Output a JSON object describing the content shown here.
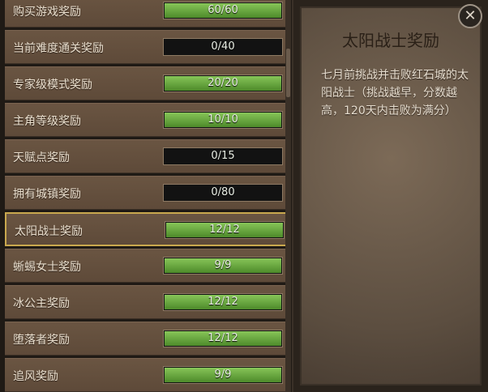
{
  "rewards": [
    {
      "name": "购买游戏奖励",
      "progress": "60/60",
      "fraction": 1.0,
      "selected": false
    },
    {
      "name": "当前难度通关奖励",
      "progress": "0/40",
      "fraction": 0.0,
      "selected": false
    },
    {
      "name": "专家级模式奖励",
      "progress": "20/20",
      "fraction": 1.0,
      "selected": false
    },
    {
      "name": "主角等级奖励",
      "progress": "10/10",
      "fraction": 1.0,
      "selected": false
    },
    {
      "name": "天赋点奖励",
      "progress": "0/15",
      "fraction": 0.0,
      "selected": false
    },
    {
      "name": "拥有城镇奖励",
      "progress": "0/80",
      "fraction": 0.0,
      "selected": false
    },
    {
      "name": "太阳战士奖励",
      "progress": "12/12",
      "fraction": 1.0,
      "selected": true
    },
    {
      "name": "蜥蜴女士奖励",
      "progress": "9/9",
      "fraction": 1.0,
      "selected": false
    },
    {
      "name": "冰公主奖励",
      "progress": "12/12",
      "fraction": 1.0,
      "selected": false
    },
    {
      "name": "堕落者奖励",
      "progress": "12/12",
      "fraction": 1.0,
      "selected": false
    },
    {
      "name": "追风奖励",
      "progress": "9/9",
      "fraction": 1.0,
      "selected": false
    }
  ],
  "detail": {
    "title": "太阳战士奖励",
    "description": "七月前挑战并击败红石城的太阳战士（挑战越早，分数越高，120天内击败为满分）"
  },
  "close_icon": "✕",
  "colors": {
    "bar_fill": "#6aa83f",
    "selected_border": "#c9a84e"
  }
}
